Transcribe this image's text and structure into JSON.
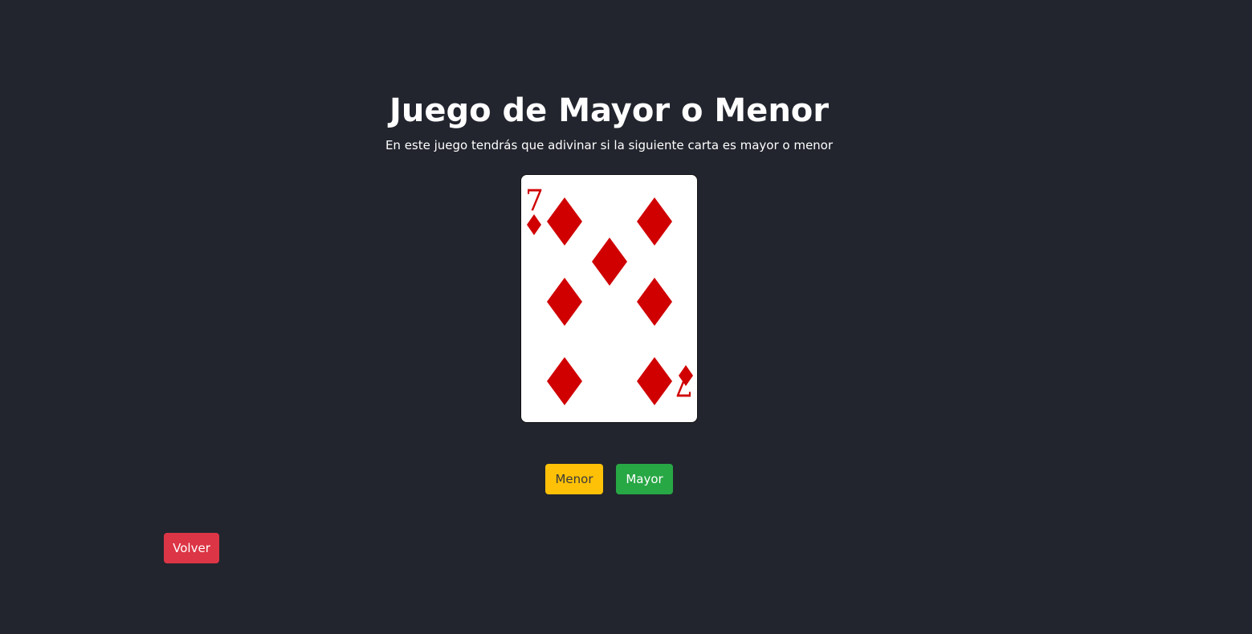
{
  "game": {
    "title": "Juego de Mayor o Menor",
    "subtitle": "En este juego tendrás que adivinar si la siguiente carta es mayor o menor"
  },
  "card": {
    "rank": "7",
    "suit": "diamonds",
    "suit_color": "#d00000"
  },
  "controls": {
    "lower_label": "Menor",
    "higher_label": "Mayor",
    "back_label": "Volver"
  },
  "colors": {
    "background": "#22252e",
    "lower_button": "#ffc107",
    "higher_button": "#28a745",
    "back_button": "#dc3545"
  }
}
